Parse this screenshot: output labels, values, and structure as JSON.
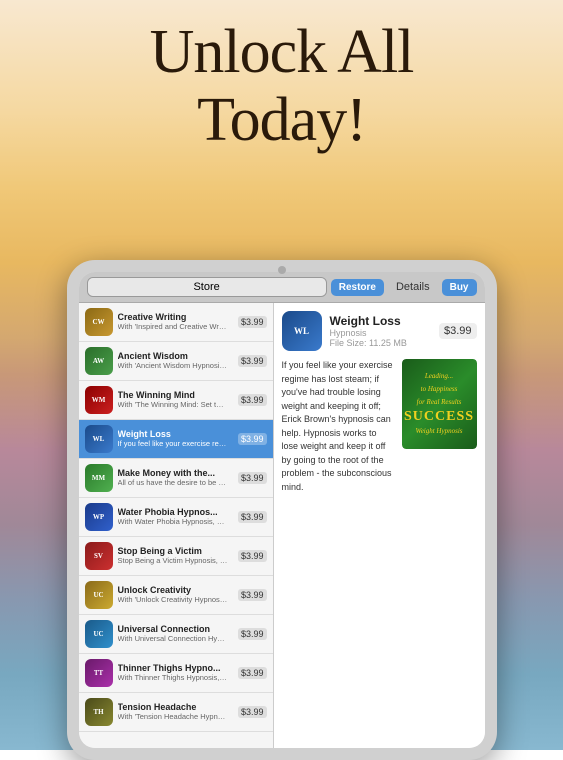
{
  "background": {
    "gradient_description": "warm sunrise to ocean colors"
  },
  "header": {
    "title_line1": "Unlock All",
    "title_line2": "Today!"
  },
  "tablet": {
    "camera_label": "front camera",
    "store_tab": "Store",
    "restore_button": "Restore",
    "details_label": "Details",
    "buy_button": "Buy"
  },
  "detail_panel": {
    "title": "Weight Loss",
    "subtitle_line1": "Hypnosis",
    "subtitle_line2": "File Size: 11.25 MB",
    "price": "$3.99",
    "description": "If you feel like your exercise regime has lost steam; if you've had trouble losing weight and keeping it off; Erick Brown's hypnosis can help. Hypnosis works to lose weight and keep it off by going to the root of the problem - the subconscious mind.",
    "book_top_text": "Leading...",
    "book_subtitle": "to Happiness",
    "book_bundle_text": "for Real Results",
    "book_main_word": "SUCCESS",
    "book_bottom_text": "Weight Hypnosis"
  },
  "list_items": [
    {
      "id": "creative-writing",
      "title": "Creative Writing",
      "desc": "With 'Inspired and Creative Writing Hypnosis', unlock your creativity and wi...",
      "price": "$3.99",
      "icon_class": "icon-creative",
      "icon_text": "CW"
    },
    {
      "id": "ancient-wisdom",
      "title": "Ancient Wisdom",
      "desc": "With 'Ancient Wisdom Hypnosis', tap into the knowledge and wisdom that...",
      "price": "$3.99",
      "icon_class": "icon-ancient",
      "icon_text": "AW"
    },
    {
      "id": "winning-mind",
      "title": "The Winning Mind",
      "desc": "With 'The Winning Mind: Set the Competitive Edge Hypnosis', develo...",
      "price": "$3.99",
      "icon_class": "icon-winning",
      "icon_text": "WM"
    },
    {
      "id": "weight-loss",
      "title": "Weight Loss",
      "desc": "If you feel like your exercise regime has lost trouble...",
      "price": "$3.99",
      "icon_class": "icon-weightloss",
      "icon_text": "WL",
      "selected": true
    },
    {
      "id": "make-money",
      "title": "Make Money with the...",
      "desc": "All of us have the desire to be secure, healthy and able to easily meet our...",
      "price": "$3.99",
      "icon_class": "icon-money",
      "icon_text": "MM"
    },
    {
      "id": "water-phobia",
      "title": "Water Phobia Hypnos...",
      "desc": "With Water Phobia Hypnosis, overcome your fear of large bodies...",
      "price": "$3.99",
      "icon_class": "icon-phobia",
      "icon_text": "WP"
    },
    {
      "id": "stop-victim",
      "title": "Stop Being a Victim",
      "desc": "Stop Being a Victim Hypnosis, take control of your path! Gain the...",
      "price": "$3.99",
      "icon_class": "icon-victim",
      "icon_text": "SV"
    },
    {
      "id": "unlock-creativity",
      "title": "Unlock Creativity",
      "desc": "With 'Unlock Creativity Hypnosis', learn how to set free your creative si...",
      "price": "$3.99",
      "icon_class": "icon-creativity",
      "icon_text": "UC"
    },
    {
      "id": "universal-connection",
      "title": "Universal Connection",
      "desc": "With Universal Connection Hypnosis, learn to connect with the energy and...",
      "price": "$3.99",
      "icon_class": "icon-universal",
      "icon_text": "UC"
    },
    {
      "id": "thinner-thighs",
      "title": "Thinner Thighs Hypno...",
      "desc": "With Thinner Thighs Hypnosis, get legs that you want to show off. Let...",
      "price": "$3.99",
      "icon_class": "icon-thighs",
      "icon_text": "TT"
    },
    {
      "id": "tension-headache",
      "title": "Tension Headache",
      "desc": "With 'Tension Headache Hypnosis', deep relaxation suggestions will mas...",
      "price": "$3.99",
      "icon_class": "icon-tension",
      "icon_text": "TH"
    }
  ]
}
